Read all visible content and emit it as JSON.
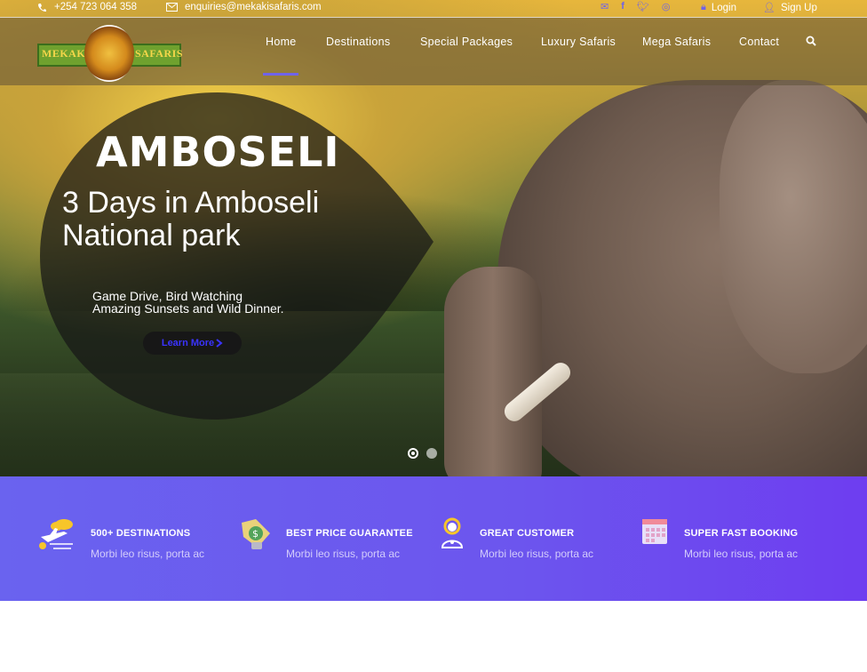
{
  "topbar": {
    "phone": "+254 723 064 358",
    "email": "enquiries@mekakisafaris.com",
    "login": "Login",
    "signup": "Sign Up",
    "social": [
      "envelope-icon",
      "facebook-icon",
      "twitter-icon",
      "instagram-icon"
    ]
  },
  "logo": {
    "left_word": "MEKAKI",
    "right_word": "SAFARIS"
  },
  "nav": {
    "items": [
      "Home",
      "Destinations",
      "Special Packages",
      "Luxury Safaris",
      "Mega Safaris",
      "Contact"
    ],
    "active": "Home"
  },
  "hero": {
    "title": "AMBOSELI",
    "subtitle": "3 Days in Amboseli National park",
    "desc_line1": "Game Drive, Bird Watching",
    "desc_line2": "Amazing Sunsets and Wild Dinner.",
    "cta": "Learn More"
  },
  "features": [
    {
      "title": "500+ DESTINATIONS",
      "desc": "Morbi leo risus, porta ac",
      "icon": "plane-cloud-icon"
    },
    {
      "title": "BEST PRICE GUARANTEE",
      "desc": "Morbi leo risus, porta ac",
      "icon": "price-tag-icon"
    },
    {
      "title": "GREAT CUSTOMER",
      "desc": "Morbi leo risus, porta ac",
      "icon": "customer-support-icon"
    },
    {
      "title": "SUPER FAST BOOKING",
      "desc": "Morbi leo risus, porta ac",
      "icon": "calendar-icon"
    }
  ],
  "colors": {
    "accent": "#6f63e9",
    "features_bg_start": "#6a63ef",
    "features_bg_end": "#6e3df0",
    "cta_text": "#3a33ff"
  }
}
